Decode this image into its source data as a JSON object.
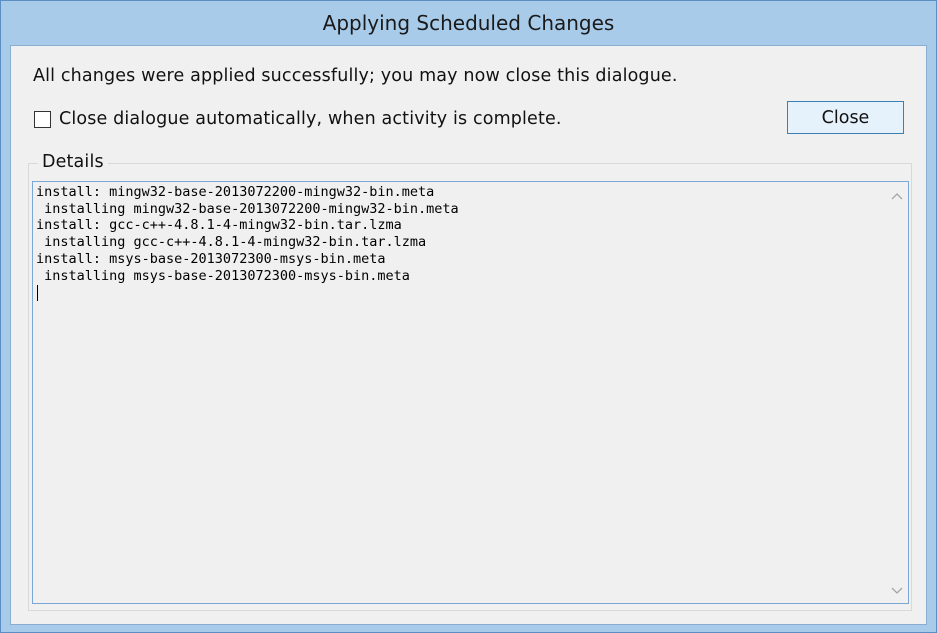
{
  "window": {
    "title": "Applying Scheduled Changes"
  },
  "dialog": {
    "message": "All changes were applied successfully; you may now close this dialogue.",
    "auto_close_label": "Close dialogue automatically, when activity is complete.",
    "auto_close_checked": false,
    "close_label": "Close"
  },
  "details": {
    "legend": "Details",
    "lines": [
      "install: mingw32-base-2013072200-mingw32-bin.meta",
      " installing mingw32-base-2013072200-mingw32-bin.meta",
      "install: gcc-c++-4.8.1-4-mingw32-bin.tar.lzma",
      " installing gcc-c++-4.8.1-4-mingw32-bin.tar.lzma",
      "install: msys-base-2013072300-msys-bin.meta",
      " installing msys-base-2013072300-msys-bin.meta"
    ]
  },
  "icons": {
    "scroll_up": "chevron-up-icon",
    "scroll_down": "chevron-down-icon"
  },
  "colors": {
    "title_bar": "#a9cbea",
    "client_background": "#f0f0f0",
    "button_face": "#e5f1fb",
    "button_border": "#3c7fb1",
    "log_border": "#7aa7d6"
  }
}
